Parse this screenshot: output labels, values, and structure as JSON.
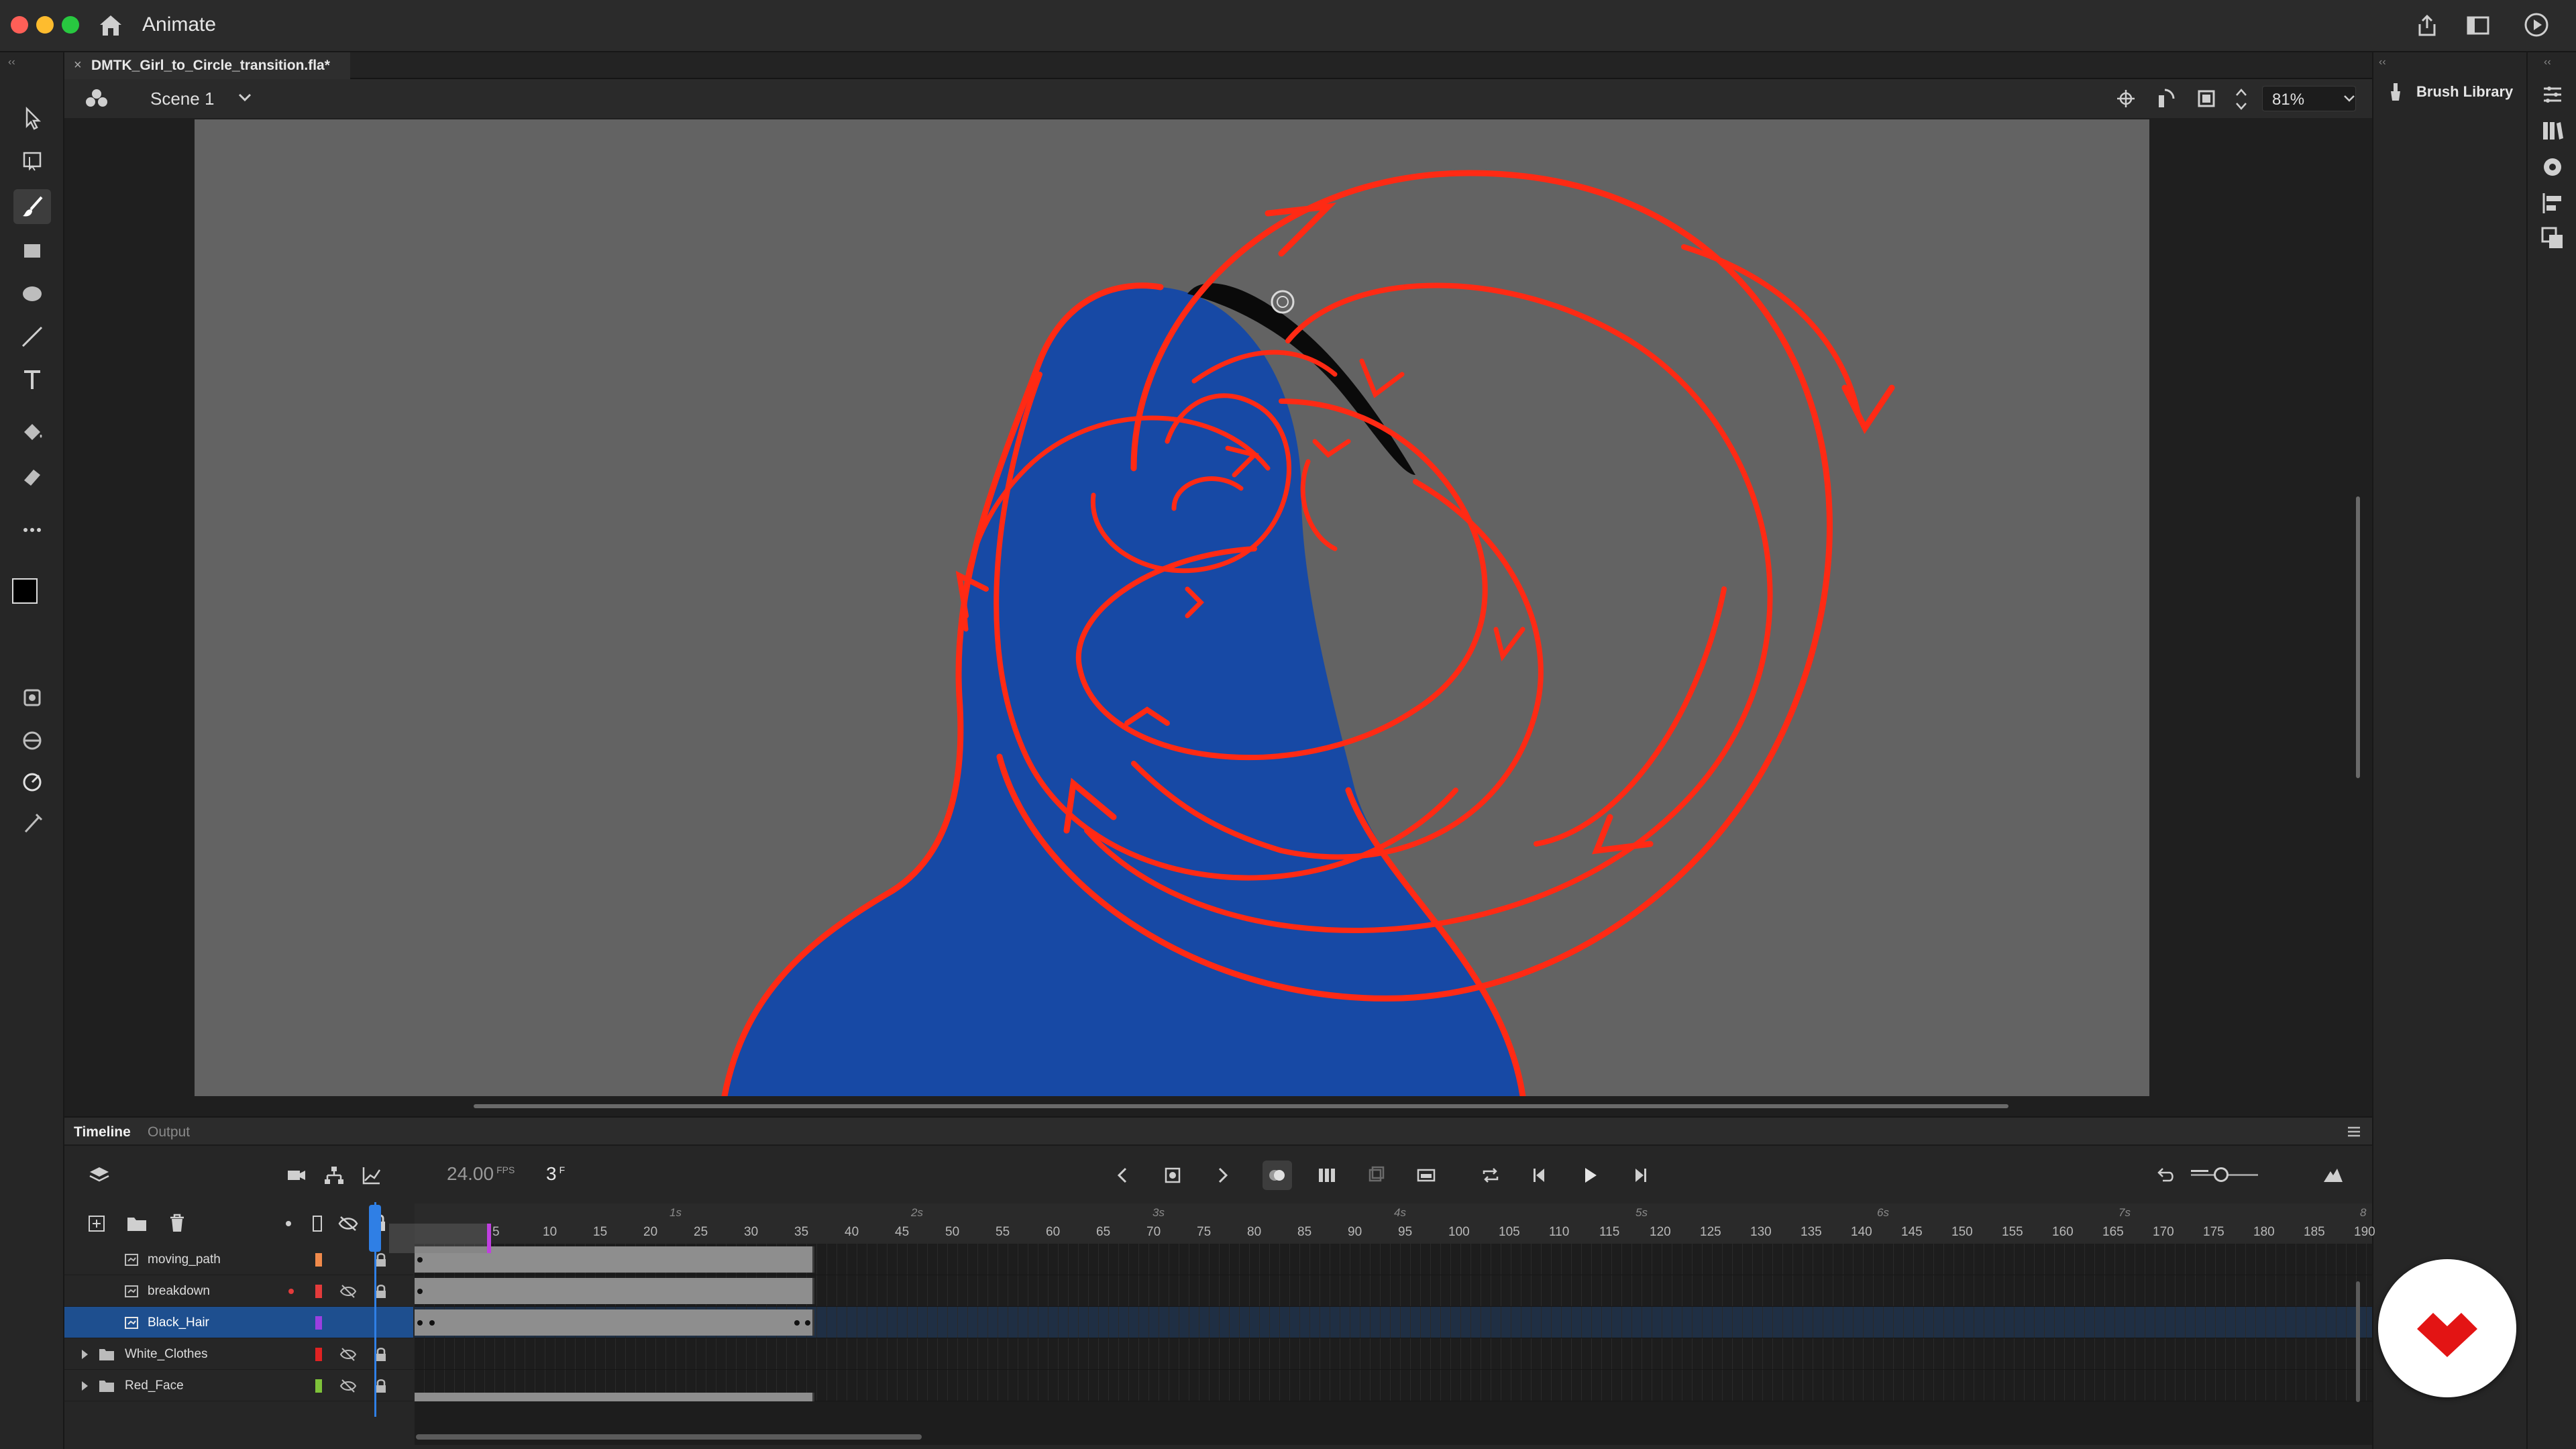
{
  "app": {
    "name": "Animate"
  },
  "document": {
    "tab_title": "DMTK_Girl_to_Circle_transition.fla*"
  },
  "scene": {
    "name": "Scene 1",
    "zoom": "81%"
  },
  "right_panel": {
    "brush_library_label": "Brush Library"
  },
  "timeline": {
    "tabs": [
      {
        "label": "Timeline"
      },
      {
        "label": "Output"
      }
    ],
    "fps": "24.00",
    "fps_unit": "FPS",
    "current_frame": "3",
    "current_frame_unit": "F",
    "ruler_frames": [
      "5",
      "10",
      "15",
      "20",
      "25",
      "30",
      "35",
      "40",
      "45",
      "50",
      "55",
      "60",
      "65",
      "70",
      "75",
      "80",
      "85",
      "90",
      "95",
      "100",
      "105",
      "110",
      "115",
      "120",
      "125",
      "130",
      "135",
      "140",
      "145",
      "150",
      "155",
      "160",
      "165",
      "170",
      "175",
      "180",
      "185",
      "190"
    ],
    "ruler_seconds": [
      "1s",
      "2s",
      "3s",
      "4s",
      "5s",
      "6s",
      "7s",
      "8"
    ],
    "layers": [
      {
        "name": "moving_path",
        "color": "#f08a4b",
        "selected": false
      },
      {
        "name": "breakdown",
        "color": "#e43b3b",
        "selected": false
      },
      {
        "name": "Black_Hair",
        "color": "#9b3fe0",
        "selected": true
      },
      {
        "name": "White_Clothes",
        "color": "#e02222",
        "selected": false
      },
      {
        "name": "Red_Face",
        "color": "#7ec23a",
        "selected": false
      }
    ]
  },
  "colors": {
    "stage_bg": "#636363",
    "figure_blue": "#1749a5",
    "stroke_red": "#ff2a14",
    "accent_blue": "#2f7fe5"
  }
}
